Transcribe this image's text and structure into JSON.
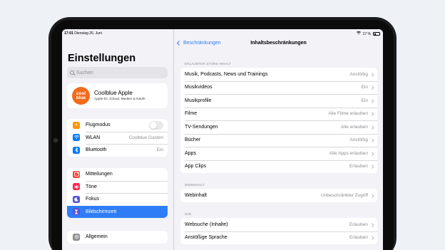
{
  "status_bar": {
    "time": "17:01",
    "date": "Dienstag 26. Juni",
    "battery": "17 %"
  },
  "sidebar": {
    "title": "Einstellungen",
    "search_placeholder": "Suchen",
    "profile": {
      "avatar_line1": "cool",
      "avatar_line2": "blue",
      "name": "Coolblue Apple",
      "subtitle": "Apple-ID, iCloud, Medien & Käufe"
    },
    "group1": [
      {
        "label": "Flugmodus",
        "icon": "airplane-icon",
        "color": "#ff9500"
      },
      {
        "label": "WLAN",
        "value": "Coolblue Gasten",
        "icon": "wifi-icon",
        "color": "#007aff"
      },
      {
        "label": "Bluetooth",
        "value": "Ein",
        "icon": "bluetooth-icon",
        "color": "#007aff"
      }
    ],
    "group2": [
      {
        "label": "Mitteilungen",
        "icon": "bell-icon",
        "color": "#ff3b30"
      },
      {
        "label": "Töne",
        "icon": "speaker-icon",
        "color": "#ff2d55"
      },
      {
        "label": "Fokus",
        "icon": "moon-icon",
        "color": "#5856d6"
      },
      {
        "label": "Bildschirmzeit",
        "icon": "hourglass-icon",
        "color": "#5856d6",
        "selected": true
      }
    ],
    "group3": [
      {
        "label": "Allgemein",
        "icon": "gear-icon",
        "color": "#8e8e93"
      }
    ]
  },
  "detail": {
    "back_label": "Beschränkungen",
    "title": "Inhaltsbeschränkungen",
    "sections": [
      {
        "header": "ERLAUBTER STORE-INHALT",
        "rows": [
          {
            "label": "Musik, Podcasts, News und Trainings",
            "value": "Anstößig"
          },
          {
            "label": "Musikvideos",
            "value": "Ein"
          },
          {
            "label": "Musikprofile",
            "value": "Ein"
          },
          {
            "label": "Filme",
            "value": "Alle Filme erlauben"
          },
          {
            "label": "TV-Sendungen",
            "value": "Alle erlauben"
          },
          {
            "label": "Bücher",
            "value": "Anstößig"
          },
          {
            "label": "Apps",
            "value": "Alle Apps erlauben"
          },
          {
            "label": "App Clips",
            "value": "Erlauben"
          }
        ]
      },
      {
        "header": "WEBINHALT",
        "rows": [
          {
            "label": "Webinhalt",
            "value": "Unbeschränkter Zugriff"
          }
        ]
      },
      {
        "header": "SIRI",
        "rows": [
          {
            "label": "Websuche (Inhalte)",
            "value": "Erlauben"
          },
          {
            "label": "Anstößige Sprache",
            "value": "Erlauben"
          }
        ]
      }
    ]
  }
}
